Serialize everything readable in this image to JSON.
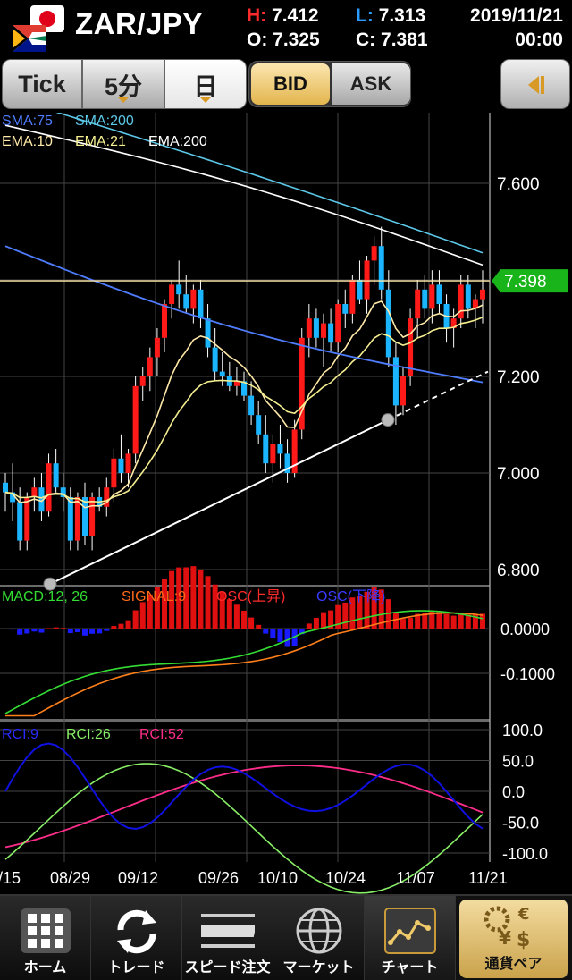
{
  "header": {
    "pair": "ZAR/JPY",
    "high_key": "H:",
    "high": "7.412",
    "low_key": "L:",
    "low": "7.313",
    "open_key": "O:",
    "open": "7.325",
    "close_key": "C:",
    "close": "7.381",
    "date": "2019/11/21",
    "time": "00:00"
  },
  "toolbar": {
    "tick": "Tick",
    "minute5": "5分",
    "day": "日",
    "bid": "BID",
    "ask": "ASK"
  },
  "colors": {
    "up_candle": "#ff1a1a",
    "down_candle": "#1ab4ff",
    "sma75": "#4f7dff",
    "sma200": "#5cc8e8",
    "ema10": "#ffe9a8",
    "ema21": "#f5ef90",
    "ema200": "#ffffff",
    "macd": "#33dd33",
    "signal": "#ff7f1a",
    "osc_up": "#e01010",
    "osc_down": "#1a1aff",
    "rci9": "#1010e0",
    "rci26": "#88ee66",
    "rci52": "#ff2d8a",
    "price_tag": "#19b31a"
  },
  "chart_data": [
    {
      "type": "candlestick",
      "panel": "price",
      "indicators": [
        "SMA:75",
        "SMA:200",
        "EMA:10",
        "EMA:21",
        "EMA:200"
      ],
      "current_price_label": "7.398",
      "yticks": [
        "7.600",
        "7.200",
        "7.000",
        "6.800"
      ],
      "ylim": [
        6.78,
        7.75
      ],
      "xticks": [
        "/15",
        "08/29",
        "09/12",
        "09/26",
        "10/10",
        "10/24",
        "11/07",
        "11/21"
      ],
      "candles": [
        [
          6.98,
          7.0,
          6.92,
          6.96
        ],
        [
          6.96,
          7.02,
          6.9,
          6.94
        ],
        [
          6.94,
          6.97,
          6.84,
          6.86
        ],
        [
          6.86,
          6.96,
          6.84,
          6.95
        ],
        [
          6.95,
          6.99,
          6.92,
          6.97
        ],
        [
          6.97,
          7.0,
          6.9,
          6.92
        ],
        [
          6.92,
          7.04,
          6.91,
          7.02
        ],
        [
          7.02,
          7.05,
          6.96,
          6.97
        ],
        [
          6.97,
          7.0,
          6.92,
          6.95
        ],
        [
          6.95,
          6.97,
          6.84,
          6.86
        ],
        [
          6.86,
          6.96,
          6.84,
          6.95
        ],
        [
          6.95,
          6.98,
          6.85,
          6.87
        ],
        [
          6.87,
          6.96,
          6.84,
          6.95
        ],
        [
          6.95,
          6.97,
          6.92,
          6.93
        ],
        [
          6.93,
          6.99,
          6.91,
          6.97
        ],
        [
          6.97,
          7.05,
          6.94,
          7.03
        ],
        [
          7.03,
          7.08,
          6.98,
          7.0
        ],
        [
          7.0,
          7.05,
          6.97,
          7.04
        ],
        [
          7.04,
          7.2,
          7.02,
          7.18
        ],
        [
          7.18,
          7.22,
          7.15,
          7.2
        ],
        [
          7.2,
          7.26,
          7.17,
          7.24
        ],
        [
          7.24,
          7.3,
          7.2,
          7.28
        ],
        [
          7.28,
          7.36,
          7.25,
          7.35
        ],
        [
          7.35,
          7.4,
          7.32,
          7.39
        ],
        [
          7.39,
          7.44,
          7.34,
          7.37
        ],
        [
          7.37,
          7.41,
          7.33,
          7.34
        ],
        [
          7.34,
          7.39,
          7.31,
          7.38
        ],
        [
          7.38,
          7.4,
          7.3,
          7.32
        ],
        [
          7.32,
          7.35,
          7.24,
          7.26
        ],
        [
          7.26,
          7.3,
          7.19,
          7.21
        ],
        [
          7.21,
          7.25,
          7.18,
          7.2
        ],
        [
          7.2,
          7.23,
          7.17,
          7.18
        ],
        [
          7.18,
          7.22,
          7.16,
          7.19
        ],
        [
          7.19,
          7.21,
          7.15,
          7.16
        ],
        [
          7.16,
          7.19,
          7.1,
          7.12
        ],
        [
          7.12,
          7.15,
          7.06,
          7.08
        ],
        [
          7.08,
          7.12,
          7.0,
          7.02
        ],
        [
          7.02,
          7.08,
          6.98,
          7.06
        ],
        [
          7.06,
          7.1,
          7.01,
          7.04
        ],
        [
          7.04,
          7.07,
          6.98,
          7.0
        ],
        [
          7.0,
          7.11,
          6.99,
          7.09
        ],
        [
          7.09,
          7.3,
          7.07,
          7.28
        ],
        [
          7.28,
          7.35,
          7.24,
          7.32
        ],
        [
          7.32,
          7.34,
          7.26,
          7.28
        ],
        [
          7.28,
          7.33,
          7.22,
          7.31
        ],
        [
          7.31,
          7.34,
          7.25,
          7.27
        ],
        [
          7.27,
          7.36,
          7.25,
          7.35
        ],
        [
          7.35,
          7.38,
          7.3,
          7.33
        ],
        [
          7.33,
          7.41,
          7.31,
          7.4
        ],
        [
          7.4,
          7.44,
          7.35,
          7.36
        ],
        [
          7.36,
          7.45,
          7.33,
          7.44
        ],
        [
          7.44,
          7.49,
          7.39,
          7.47
        ],
        [
          7.47,
          7.51,
          7.36,
          7.38
        ],
        [
          7.38,
          7.42,
          7.22,
          7.24
        ],
        [
          7.24,
          7.27,
          7.1,
          7.14
        ],
        [
          7.14,
          7.22,
          7.12,
          7.2
        ],
        [
          7.2,
          7.34,
          7.18,
          7.32
        ],
        [
          7.32,
          7.4,
          7.28,
          7.38
        ],
        [
          7.38,
          7.41,
          7.32,
          7.34
        ],
        [
          7.34,
          7.42,
          7.31,
          7.39
        ],
        [
          7.39,
          7.42,
          7.33,
          7.35
        ],
        [
          7.35,
          7.37,
          7.27,
          7.3
        ],
        [
          7.3,
          7.34,
          7.26,
          7.32
        ],
        [
          7.32,
          7.41,
          7.3,
          7.39
        ],
        [
          7.39,
          7.41,
          7.32,
          7.34
        ],
        [
          7.34,
          7.37,
          7.3,
          7.36
        ],
        [
          7.36,
          7.42,
          7.31,
          7.38
        ]
      ]
    },
    {
      "type": "line+bar",
      "panel": "macd",
      "indicators": [
        "MACD:12, 26",
        "SIGNAL:9",
        "OSC(上昇)",
        "OSC(下降)"
      ],
      "yticks": [
        "0.0000",
        "-0.1000"
      ],
      "ylim": [
        -0.19,
        0.09
      ]
    },
    {
      "type": "line",
      "panel": "rci",
      "indicators": [
        "RCI:9",
        "RCI:26",
        "RCI:52"
      ],
      "yticks": [
        "100.0",
        "50.0",
        "0.0",
        "-50.0",
        "-100.0"
      ],
      "ylim": [
        -100,
        100
      ]
    }
  ],
  "tabs": [
    {
      "label": "ホーム",
      "icon": "grid-icon"
    },
    {
      "label": "トレード",
      "icon": "refresh-icon"
    },
    {
      "label": "スピード注文",
      "icon": "speed-icon"
    },
    {
      "label": "マーケット",
      "icon": "globe-icon"
    },
    {
      "label": "チャート",
      "icon": "chart-icon"
    },
    {
      "label": "通貨ペア",
      "icon": "currency-icon"
    }
  ]
}
